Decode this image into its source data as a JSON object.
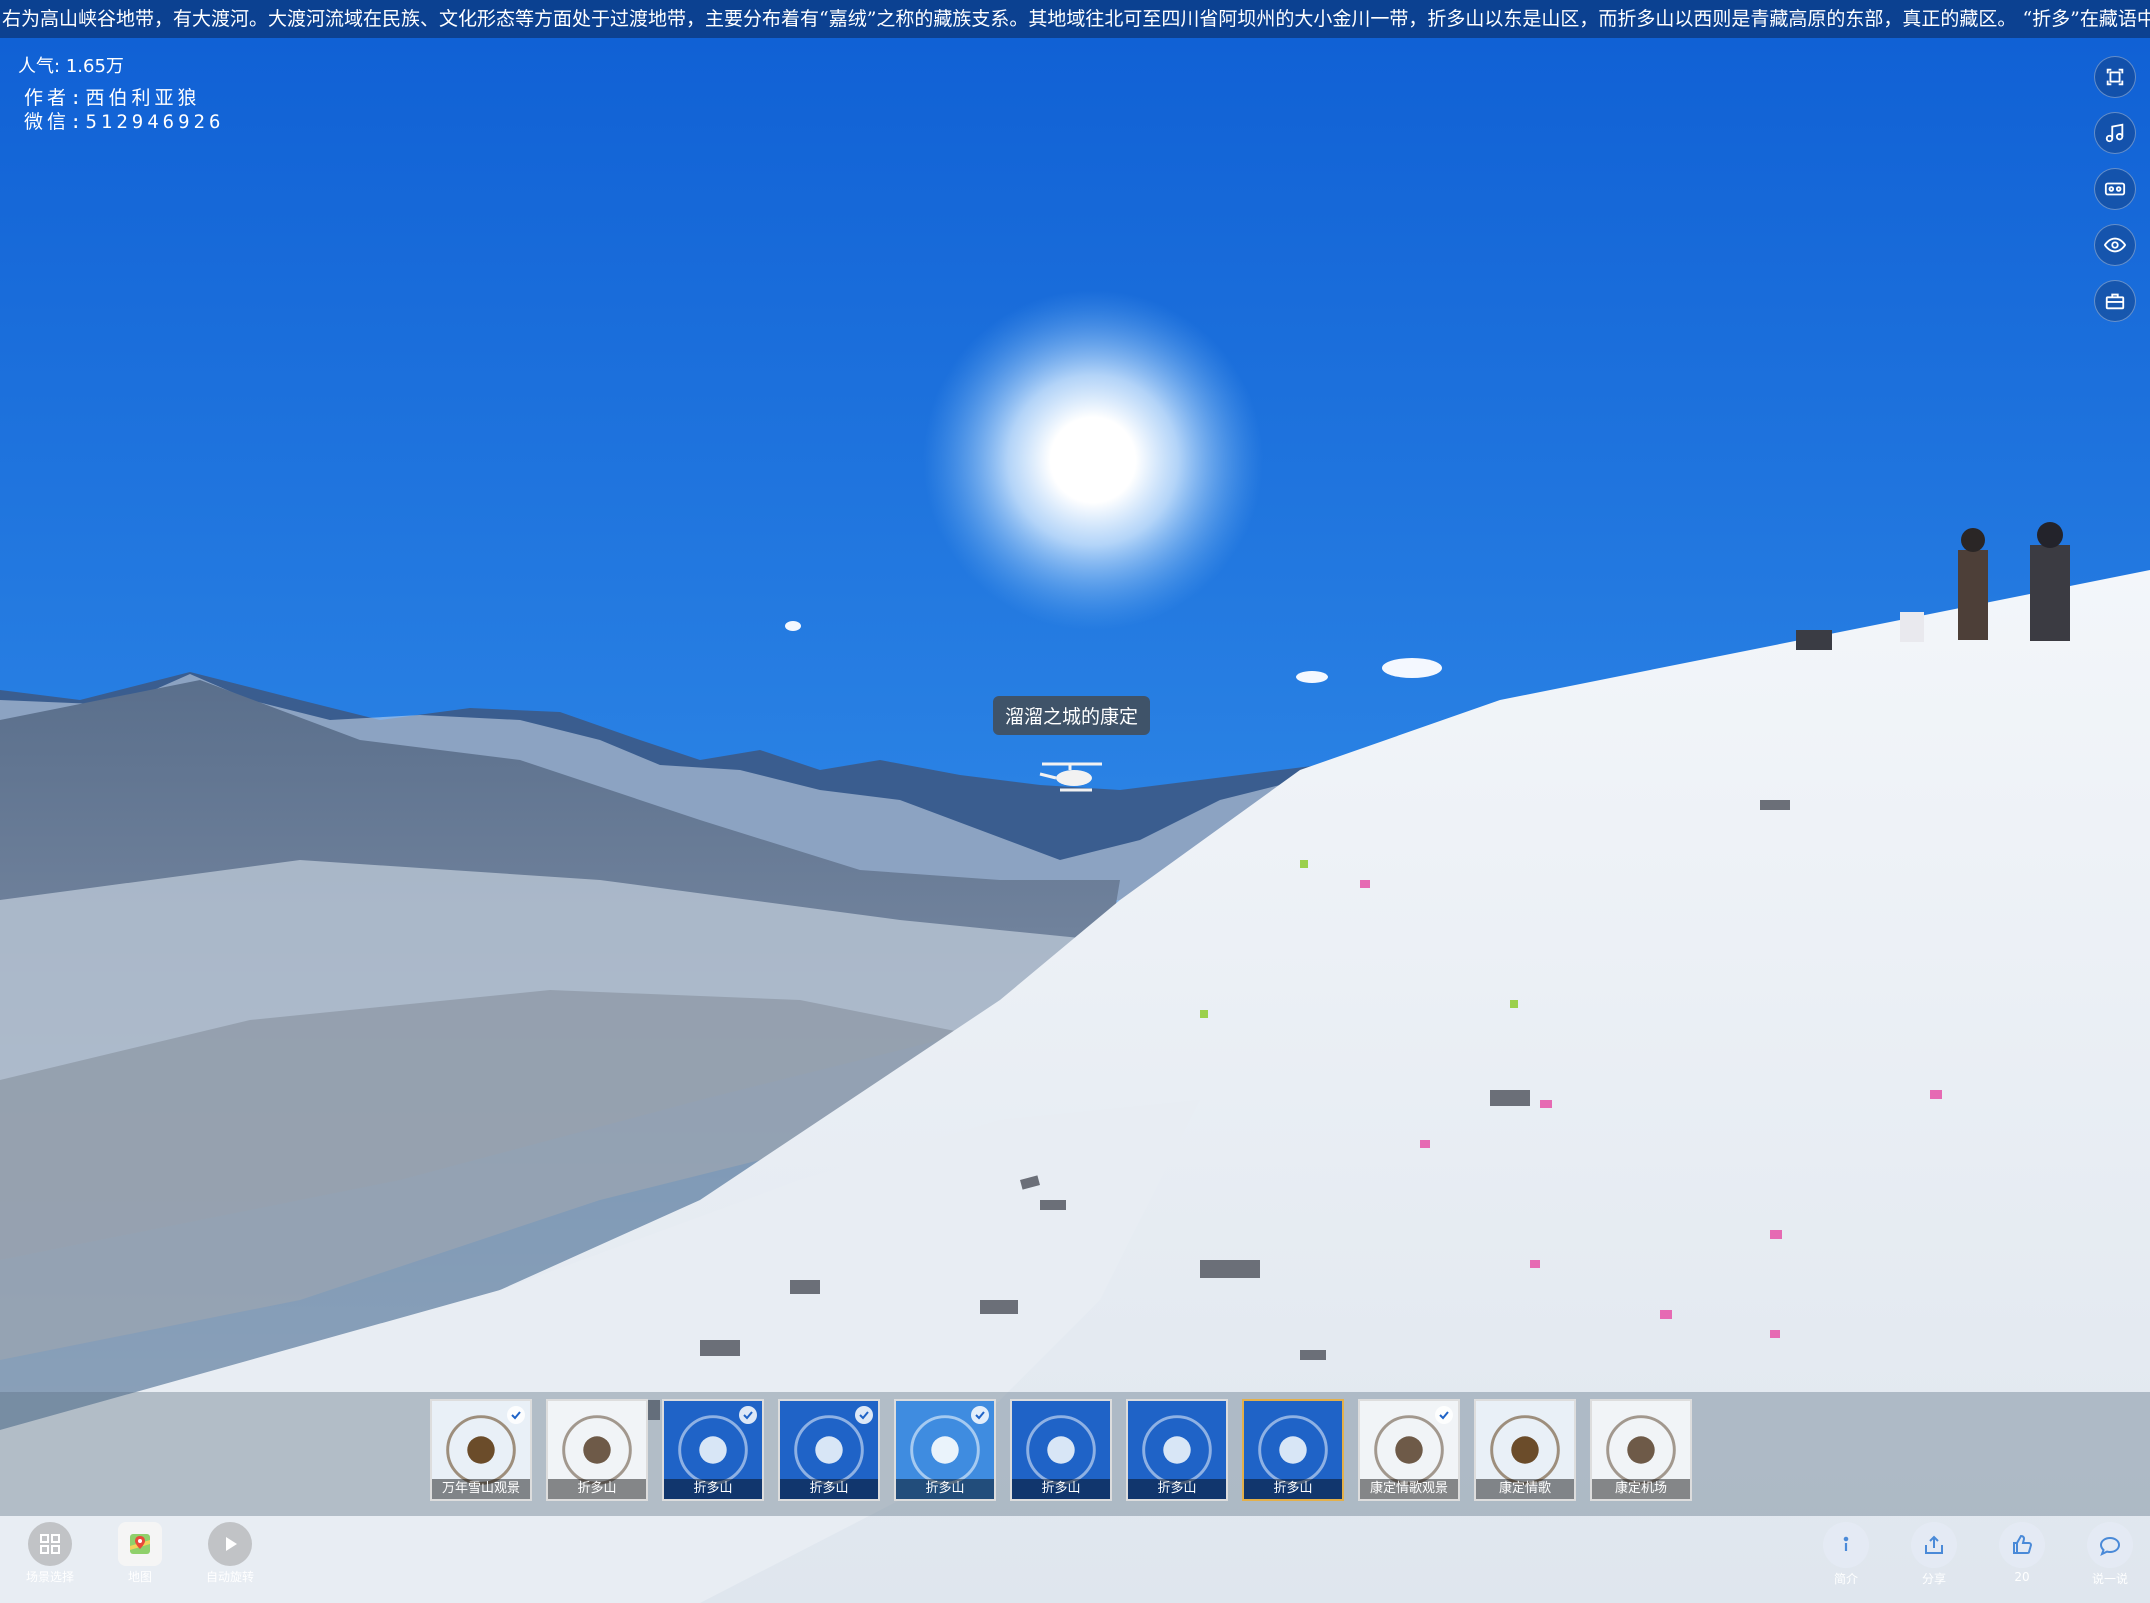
{
  "marquee": {
    "text": "右为高山峡谷地带，有大渡河。大渡河流域在民族、文化形态等方面处于过渡地带，主要分布着有“嘉绒”之称的藏族支系。其地域往北可至四川省阿坝州的大小金川一带，折多山以东是山区，而折多山以西则是青藏高原的东部，真正的藏区。 “折多”在藏语中是弯曲的意思，写"
  },
  "stats": {
    "popularity_label": "人气:",
    "popularity_value": "1.65万"
  },
  "author": {
    "line1": "作者:西伯利亚狼",
    "line2": "微信:512946926"
  },
  "right_toolbar": {
    "items": [
      {
        "name": "fullscreen-icon"
      },
      {
        "name": "music-icon"
      },
      {
        "name": "vr-icon"
      },
      {
        "name": "gyroscope-eye-icon"
      },
      {
        "name": "toolbox-icon"
      }
    ]
  },
  "hotspot": {
    "label": "溜溜之城的康定",
    "icon": "helicopter-icon"
  },
  "thumbnails": [
    {
      "caption": "万年雪山观景",
      "checked": true,
      "style": "snow"
    },
    {
      "caption": "折多山",
      "checked": false,
      "style": "white"
    },
    {
      "caption": "折多山",
      "checked": true,
      "style": "blue"
    },
    {
      "caption": "折多山",
      "checked": true,
      "style": "blue"
    },
    {
      "caption": "折多山",
      "checked": true,
      "style": "lightblue"
    },
    {
      "caption": "折多山",
      "checked": false,
      "style": "blue"
    },
    {
      "caption": "折多山",
      "checked": false,
      "style": "blue"
    },
    {
      "caption": "折多山",
      "checked": false,
      "style": "blue",
      "active": true
    },
    {
      "caption": "康定情歌观景",
      "checked": true,
      "style": "white"
    },
    {
      "caption": "康定情歌",
      "checked": false,
      "style": "snow"
    },
    {
      "caption": "康定机场",
      "checked": false,
      "style": "white"
    }
  ],
  "bottom_left": [
    {
      "label": "场景选择",
      "icon": "grid-icon"
    },
    {
      "label": "地图",
      "icon": "map-icon"
    },
    {
      "label": "自动旋转",
      "icon": "play-icon"
    }
  ],
  "bottom_right": [
    {
      "label": "简介",
      "icon": "info-icon"
    },
    {
      "label": "分享",
      "icon": "share-icon"
    },
    {
      "label": "20",
      "icon": "like-icon"
    },
    {
      "label": "说一说",
      "icon": "comment-icon"
    }
  ],
  "colors": {
    "sky_top": "#1160d6",
    "sky_bottom": "#7fb8ee",
    "snow": "#eef2f7",
    "active_border": "#e3b04b"
  }
}
